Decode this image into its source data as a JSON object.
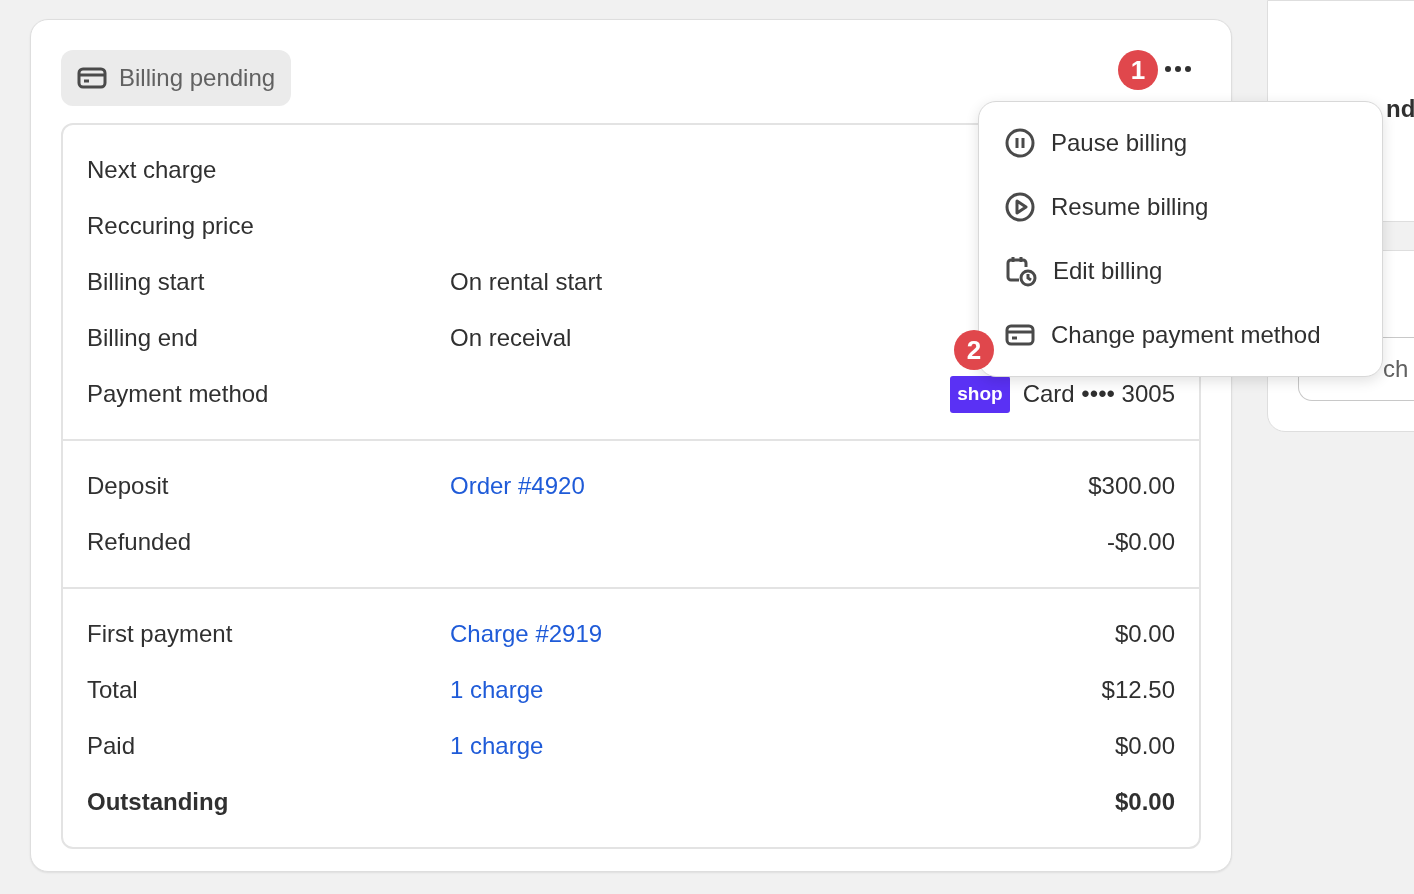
{
  "status_badge": {
    "label": "Billing pending"
  },
  "sections": [
    {
      "rows": [
        {
          "label": "Next charge"
        },
        {
          "label": "Reccuring price"
        },
        {
          "label": "Billing start",
          "detail": "On rental start",
          "link": false
        },
        {
          "label": "Billing end",
          "detail": "On receival",
          "link": false
        },
        {
          "label": "Payment method",
          "badge": "shop",
          "value": "Card •••• 3005"
        }
      ]
    },
    {
      "rows": [
        {
          "label": "Deposit",
          "detail": "Order #4920",
          "link": true,
          "value": "$300.00"
        },
        {
          "label": "Refunded",
          "value": "-$0.00"
        }
      ]
    },
    {
      "rows": [
        {
          "label": "First payment",
          "detail": "Charge #2919",
          "link": true,
          "value": "$0.00"
        },
        {
          "label": "Total",
          "detail": "1 charge",
          "link": true,
          "value": "$12.50"
        },
        {
          "label": "Paid",
          "detail": "1 charge",
          "link": true,
          "value": "$0.00"
        },
        {
          "label": "Outstanding",
          "value": "$0.00",
          "emphasis": true
        }
      ]
    }
  ],
  "menu": {
    "items": [
      {
        "label": "Pause billing",
        "kind": "pause"
      },
      {
        "label": "Resume billing",
        "kind": "play"
      },
      {
        "label": "Edit billing",
        "kind": "calendar"
      },
      {
        "label": "Change payment method",
        "kind": "card"
      }
    ]
  },
  "step_markers": [
    {
      "label": "1"
    },
    {
      "label": "2"
    }
  ],
  "side_panel": {
    "heading": "nd",
    "field_value": "ch"
  }
}
